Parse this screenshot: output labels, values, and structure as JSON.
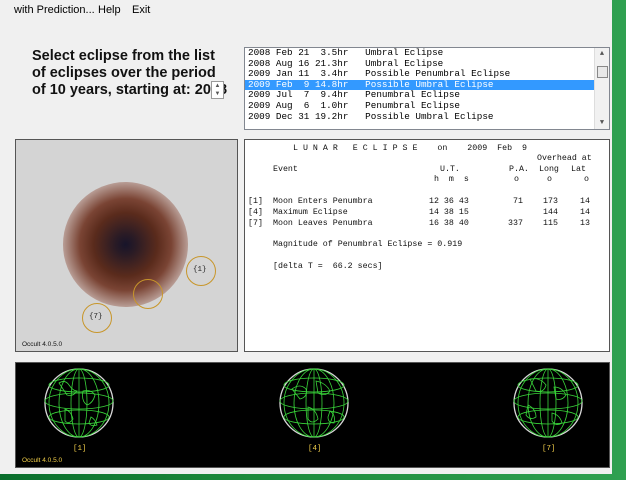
{
  "menu": {
    "items": [
      "with Prediction...",
      "Help",
      "Exit"
    ]
  },
  "prompt": {
    "line1": "Select eclipse from the list",
    "line2": "of eclipses over the period",
    "line3": "of 10 years, starting at: 2008"
  },
  "eclipse_list": {
    "rows": [
      "2008 Feb 21  3.5hr   Umbral Eclipse",
      "2008 Aug 16 21.3hr   Umbral Eclipse",
      "2009 Jan 11  3.4hr   Possible Penumbral Eclipse",
      "2009 Feb  9 14.8hr   Possible Umbral Eclipse",
      "2009 Jul  7  9.4hr   Penumbral Eclipse",
      "2009 Aug  6  1.0hr   Penumbral Eclipse",
      "2009 Dec 31 19.2hr   Possible Umbral Eclipse"
    ],
    "selected_index": 3
  },
  "moon_panel": {
    "label_1": "{1}",
    "label_7": "{7}",
    "version": "Occult 4.0.5.0"
  },
  "report": {
    "title": "L U N A R   E C L I P S E    on    2009  Feb  9",
    "overhead": "Overhead at",
    "h_event": "Event",
    "h_ut": "U.T.",
    "h_pa": "P.A.",
    "h_long": "Long",
    "h_lat": "Lat",
    "h_hms": "h  m  s",
    "h_o1": "o",
    "h_o2": "o",
    "h_o3": "o",
    "events": [
      {
        "id": "[1]",
        "name": "Moon Enters Penumbra",
        "ut": "12 36 43",
        "pa": "71",
        "long": "173",
        "lat": "14"
      },
      {
        "id": "[4]",
        "name": "Maximum Eclipse",
        "ut": "14 38 15",
        "pa": "",
        "long": "144",
        "lat": "14"
      },
      {
        "id": "[7]",
        "name": "Moon Leaves Penumbra",
        "ut": "16 38 40",
        "pa": "337",
        "long": "115",
        "lat": "13"
      }
    ],
    "magnitude": "Magnitude of Penumbral Eclipse = 0.919",
    "delta_t": "[delta T =  66.2 secs]"
  },
  "globes": {
    "labels": [
      "[1]",
      "[4]",
      "[7]"
    ],
    "version": "Occult 4.0.5.0"
  },
  "colors": {
    "selection": "#3399ff",
    "globe_grid": "#39d53a",
    "ring": "#c8962a",
    "label": "#f3d04a"
  }
}
